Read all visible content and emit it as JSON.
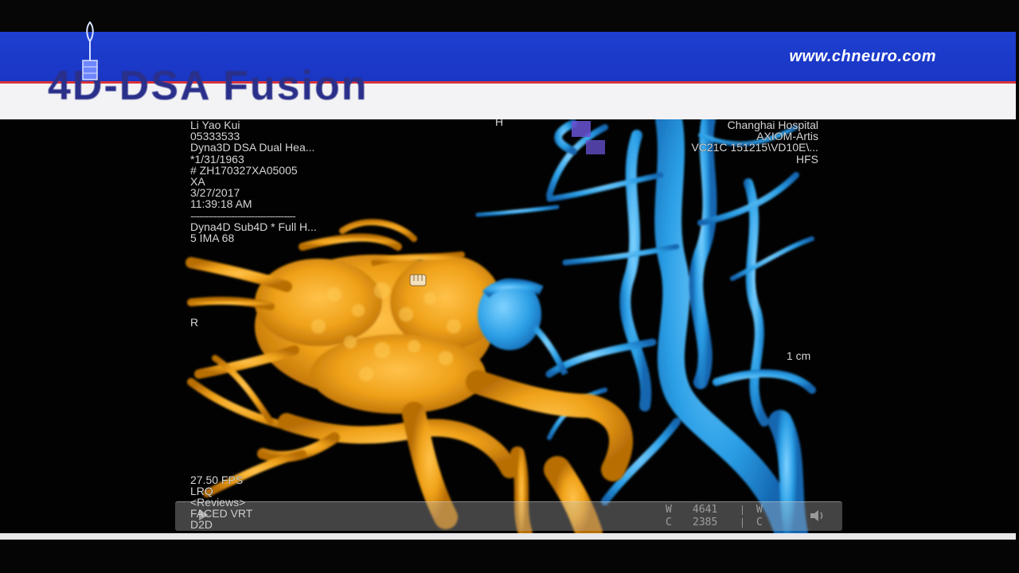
{
  "slide": {
    "url": "www.chneuro.com",
    "title": "4D-DSA Fusion"
  },
  "viewer": {
    "top_left_info": [
      "Li Yao Kui",
      "05333533",
      "Dyna3D DSA Dual Hea...",
      "*1/31/1963",
      "# ZH170327XA05005",
      "XA",
      "3/27/2017",
      "11:39:18 AM",
      "------------------------------------",
      "Dyna4D Sub4D * Full H...",
      "5 IMA 68"
    ],
    "top_right_info": [
      "Changhai Hospital",
      "AXIOM-Artis",
      "VC21C 151215\\VD10E\\...",
      "HFS"
    ],
    "orientation_marker_left": "R",
    "orientation_marker_top": "H",
    "scale_label": "1 cm",
    "bottom_left_info": [
      "27.50 FPS",
      "LRQ",
      "<Reviews>",
      "FACED VRT",
      "D2D"
    ]
  },
  "toolbar": {
    "window_label": "W",
    "window_value": "4641",
    "center_label": "C",
    "center_value": "2385",
    "window_label_2": "W",
    "center_label_2": "C"
  },
  "icons": {
    "logo": "institution-logo-icon",
    "play": "play-icon",
    "volume": "volume-icon"
  },
  "colors": {
    "header_blue": "#1e3fd0",
    "header_red_line": "#d8343c",
    "title_color": "#2a2f8a",
    "vessel_orange": "#f0a21a",
    "vessel_blue": "#2b9fe6"
  }
}
